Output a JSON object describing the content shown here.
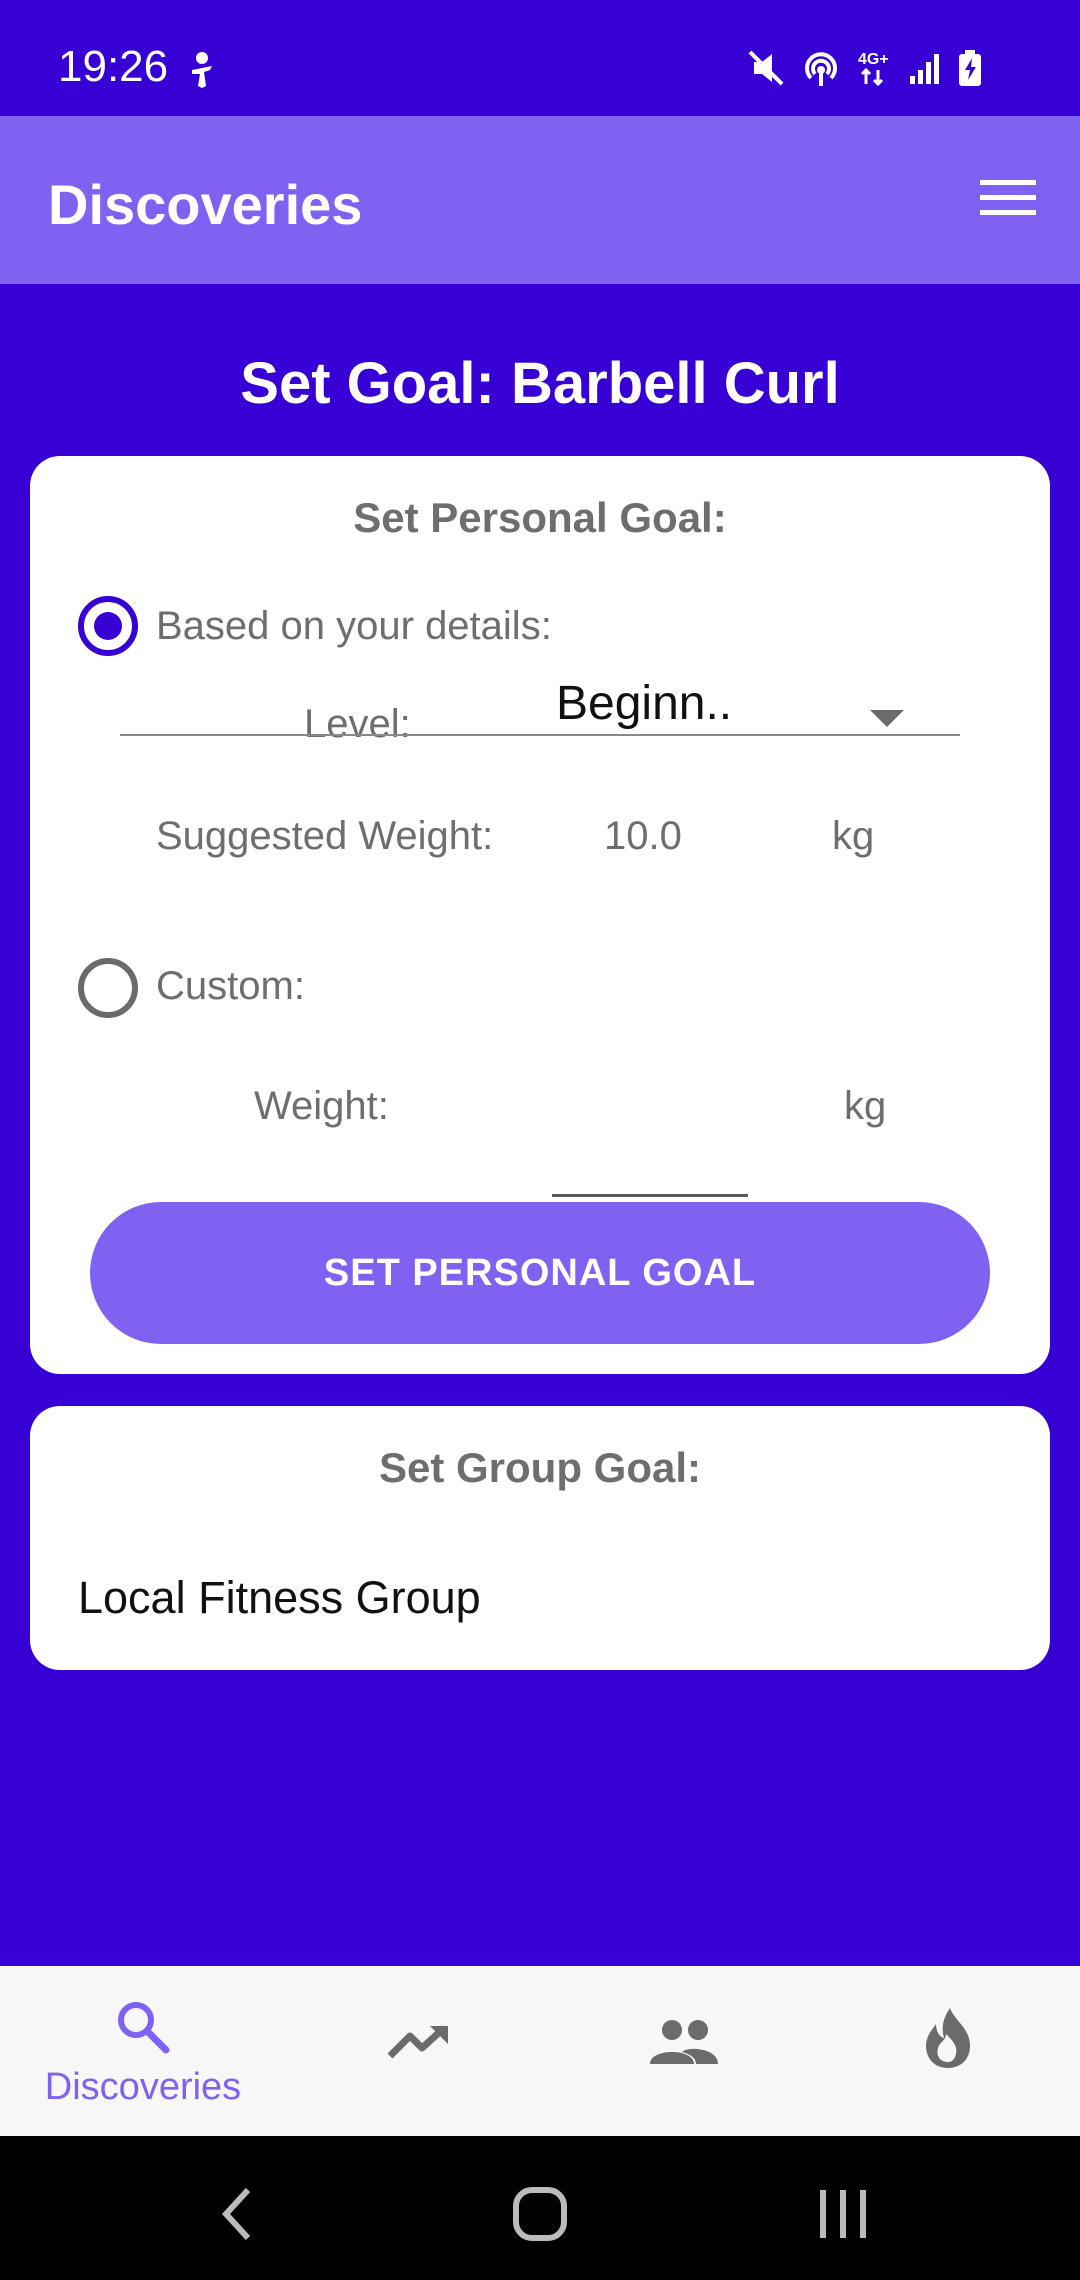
{
  "status_bar": {
    "time": "19:26",
    "icons": [
      "accessibility-icon",
      "mute-icon",
      "hotspot-icon",
      "network-4g-icon",
      "signal-icon",
      "battery-charging-icon"
    ]
  },
  "app_bar": {
    "title": "Discoveries",
    "menu_icon": "hamburger-menu-icon"
  },
  "page": {
    "heading": "Set Goal: Barbell Curl"
  },
  "personal_goal": {
    "title": "Set Personal Goal:",
    "based_option": {
      "label": "Based on your details:",
      "checked": true
    },
    "level": {
      "label": "Level:",
      "selected": "Beginn.."
    },
    "suggested_weight": {
      "label": "Suggested Weight:",
      "value": "10.0",
      "unit": "kg"
    },
    "custom_option": {
      "label": "Custom:",
      "checked": false
    },
    "custom_weight": {
      "label": "Weight:",
      "value": "",
      "unit": "kg"
    },
    "button_label": "SET PERSONAL GOAL"
  },
  "group_goal": {
    "title": "Set Group Goal:",
    "group_name": "Local Fitness Group"
  },
  "bottom_nav": {
    "items": [
      {
        "icon": "search-icon",
        "label": "Discoveries",
        "active": true
      },
      {
        "icon": "trending-up-icon",
        "label": ""
      },
      {
        "icon": "people-icon",
        "label": ""
      },
      {
        "icon": "flame-icon",
        "label": ""
      }
    ]
  },
  "system_nav": {
    "icons": [
      "back-icon",
      "home-icon",
      "recents-icon"
    ]
  },
  "colors": {
    "background": "#3700d4",
    "accent": "#8062f3",
    "card": "#ffffff",
    "muted_text": "#6e6e6e"
  }
}
